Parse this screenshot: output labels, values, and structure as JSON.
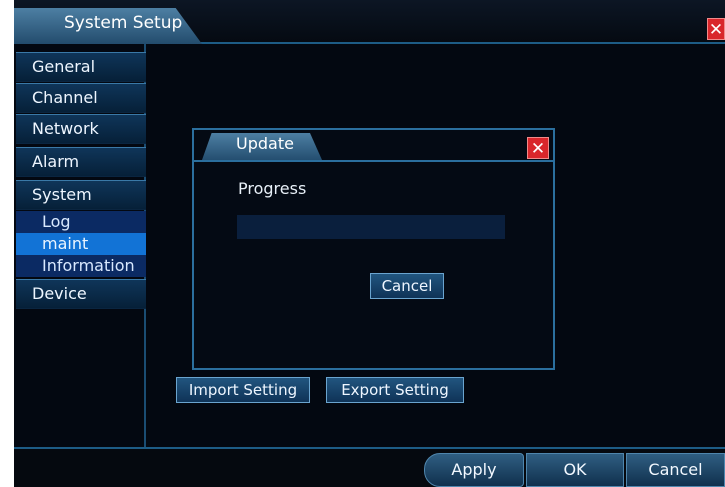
{
  "window": {
    "title": "System Setup",
    "close_glyph": "✕"
  },
  "sidebar": {
    "items": [
      {
        "label": "General"
      },
      {
        "label": "Channel"
      },
      {
        "label": "Network"
      },
      {
        "label": "Alarm"
      },
      {
        "label": "System"
      },
      {
        "label": "Device"
      }
    ],
    "subitems": [
      {
        "label": "Log",
        "selected": false
      },
      {
        "label": "maint",
        "selected": true
      },
      {
        "label": "Information",
        "selected": false
      }
    ]
  },
  "dialog": {
    "title": "Update",
    "close_glyph": "✕",
    "progress_label": "Progress",
    "progress_percent": 0,
    "cancel_label": "Cancel"
  },
  "main": {
    "import_label": "Import Setting",
    "export_label": "Export Setting"
  },
  "footer": {
    "apply_label": "Apply",
    "ok_label": "OK",
    "cancel_label": "Cancel"
  },
  "colors": {
    "accent": "#1273d6",
    "close_red": "#d9262b",
    "border_blue": "#2b6f9e"
  },
  "icons": {
    "close": "close-icon"
  }
}
